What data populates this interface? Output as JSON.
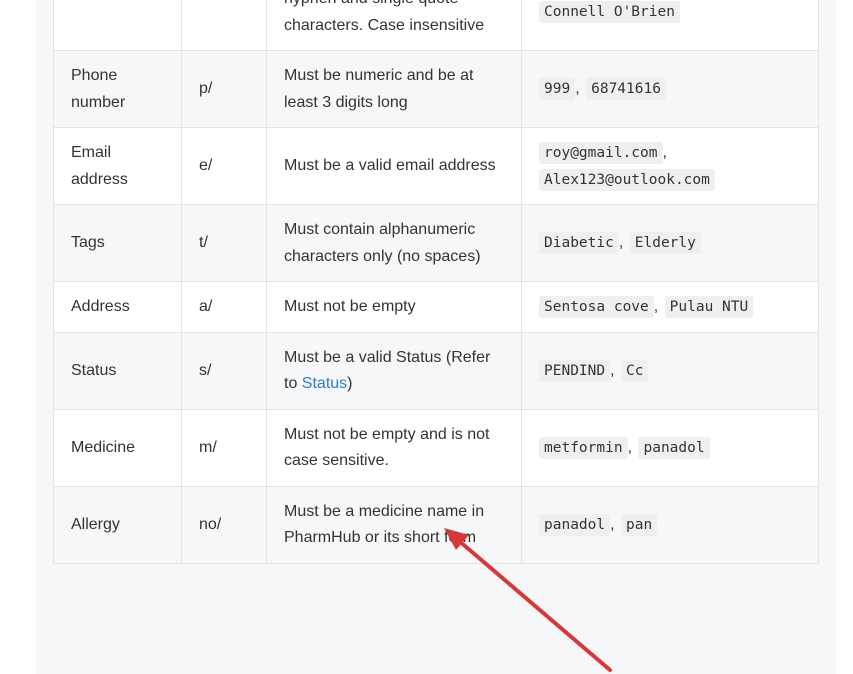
{
  "rows": [
    {
      "field": "",
      "prefix": "",
      "constraint": "hyphen and single quote characters. Case insensitive",
      "examples": [
        "Connell O'Brien"
      ]
    },
    {
      "field": "Phone number",
      "prefix": "p/",
      "constraint": "Must be numeric and be at least 3 digits long",
      "examples": [
        "999",
        "68741616"
      ]
    },
    {
      "field": "Email address",
      "prefix": "e/",
      "constraint": "Must be a valid email address",
      "examples": [
        "roy@gmail.com",
        "Alex123@outlook.com"
      ]
    },
    {
      "field": "Tags",
      "prefix": "t/",
      "constraint": "Must contain alphanumeric characters only (no spaces)",
      "examples": [
        "Diabetic",
        "Elderly"
      ]
    },
    {
      "field": "Address",
      "prefix": "a/",
      "constraint": "Must not be empty",
      "examples": [
        "Sentosa cove",
        "Pulau NTU"
      ]
    },
    {
      "field": "Status",
      "prefix": "s/",
      "constraint_before": "Must be a valid Status (Refer to ",
      "constraint_link": "Status",
      "constraint_after": ")",
      "examples": [
        "PENDIND",
        "Cc"
      ]
    },
    {
      "field": "Medicine",
      "prefix": "m/",
      "constraint": "Must not be empty and is not case sensitive.",
      "examples": [
        "metformin",
        "panadol"
      ]
    },
    {
      "field": "Allergy",
      "prefix": "no/",
      "constraint": "Must be a medicine name in PharmHub or its short form",
      "examples": [
        "panadol",
        "pan"
      ]
    }
  ],
  "separator": ",",
  "annotation": {
    "arrow_color": "#d9383a"
  },
  "colors": {
    "link": "#2f7cd6",
    "border": "#e3e4e6",
    "stripe": "#f6f7f8"
  }
}
